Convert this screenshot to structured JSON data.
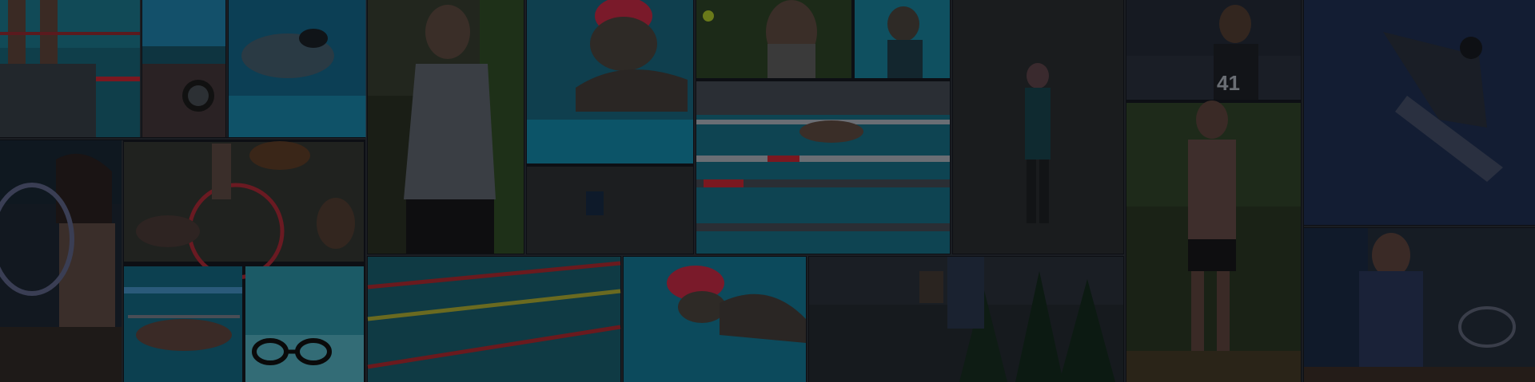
{
  "collage": {
    "description_tag": "sports-photo-collage-background",
    "jersey_number": "41",
    "colors": {
      "base": "#0d0f14",
      "pool_blue": "#0f4a5a",
      "pool_dark": "#0a2730",
      "grass_green": "#1f3a1f",
      "sky_dark": "#121a2a",
      "skin": "#3a2a24",
      "swim_cap_red": "#7a1a2a",
      "lane_red": "#7a1820",
      "lane_white": "#6a6e74",
      "snow": "#1e2226"
    }
  }
}
